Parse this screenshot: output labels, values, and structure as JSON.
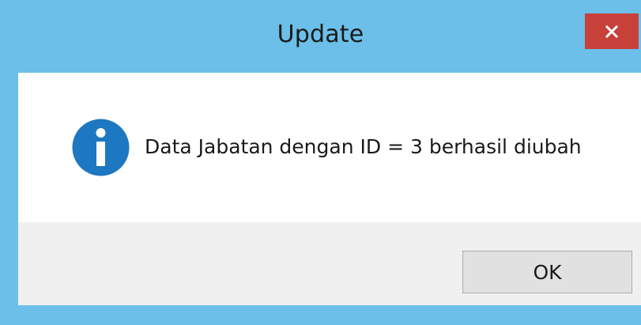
{
  "window": {
    "title": "Update",
    "close_symbol": "×"
  },
  "dialog": {
    "icon": "info-icon",
    "message": "Data Jabatan dengan ID = 3 berhasil diubah",
    "ok_label": "OK"
  },
  "colors": {
    "frame": "#6cbfe9",
    "close_button": "#c7413a",
    "info_icon": "#1d78c1",
    "footer": "#f0f0f0",
    "button": "#e1e1e1"
  }
}
